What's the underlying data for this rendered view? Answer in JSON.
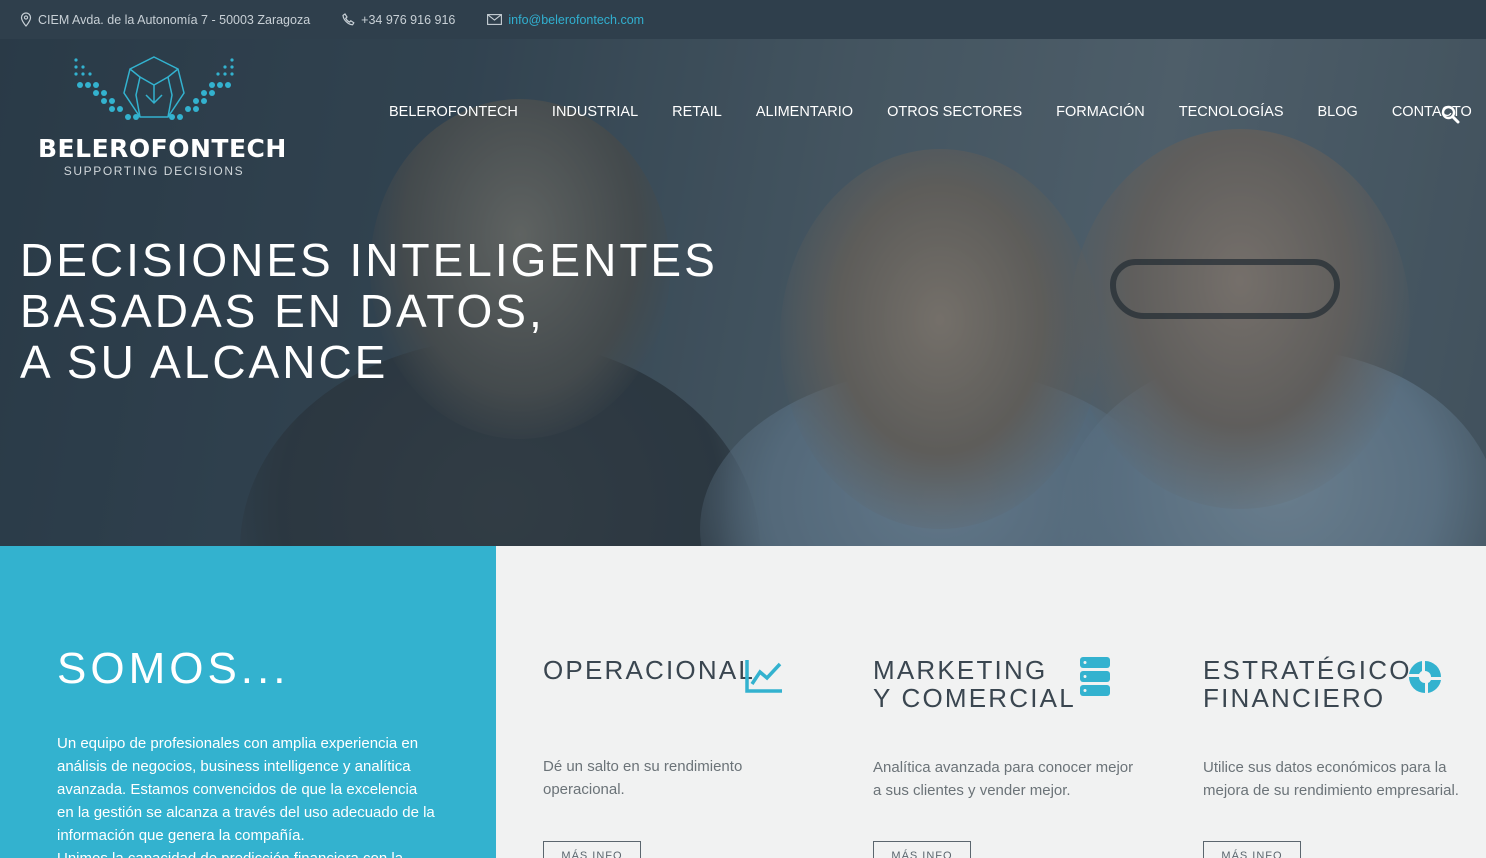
{
  "topbar": {
    "address": "CIEM Avda. de la Autonomía 7 - 50003 Zaragoza",
    "phone": "+34 976 916 916",
    "email": "info@belerofontech.com",
    "icons": [
      "location-pin-icon",
      "phone-icon",
      "envelope-icon"
    ]
  },
  "logo": {
    "brand": "BELEROFONTECH",
    "tagline": "SUPPORTING DECISIONS"
  },
  "nav": {
    "items": [
      {
        "label": "BELEROFONTECH"
      },
      {
        "label": "INDUSTRIAL"
      },
      {
        "label": "RETAIL"
      },
      {
        "label": "ALIMENTARIO"
      },
      {
        "label": "OTROS SECTORES"
      },
      {
        "label": "FORMACIÓN"
      },
      {
        "label": "TECNOLOGÍAS"
      },
      {
        "label": "BLOG"
      },
      {
        "label": "CONTACTO"
      }
    ],
    "search_icon": "search-icon"
  },
  "hero": {
    "line1": "DECISIONES INTELIGENTES",
    "line2": "BASADAS EN DATOS,",
    "line3": "A SU ALCANCE"
  },
  "somos": {
    "title": "SOMOS...",
    "text": "Un equipo de profesionales con amplia experiencia en análisis de negocios, business intelligence y analítica avanzada. Estamos convencidos de que la excelencia en la gestión se alcanza a través del uso adecuado de la información que genera la compañía.",
    "text2": "Unimos la capacidad de predicción financiera con la"
  },
  "services": [
    {
      "title1": "OPERACIONAL",
      "title2": "",
      "icon": "line-chart-icon",
      "text": "Dé un salto en su rendimiento operacional.",
      "button": "MÁS INFO"
    },
    {
      "title1": "MARKETING",
      "title2": "Y COMERCIAL",
      "icon": "database-icon",
      "text": "Analítica avanzada para conocer mejor a sus clientes y vender mejor.",
      "button": "MÁS INFO"
    },
    {
      "title1": "ESTRATÉGICO",
      "title2": "FINANCIERO",
      "icon": "pie-chart-icon",
      "text": "Utilice sus datos económicos para la mejora de su rendimiento empresarial.",
      "button": "MÁS INFO"
    }
  ],
  "colors": {
    "accent": "#33b2cf",
    "topbar": "#2f3f4c",
    "services_bg": "#f1f2f2"
  }
}
